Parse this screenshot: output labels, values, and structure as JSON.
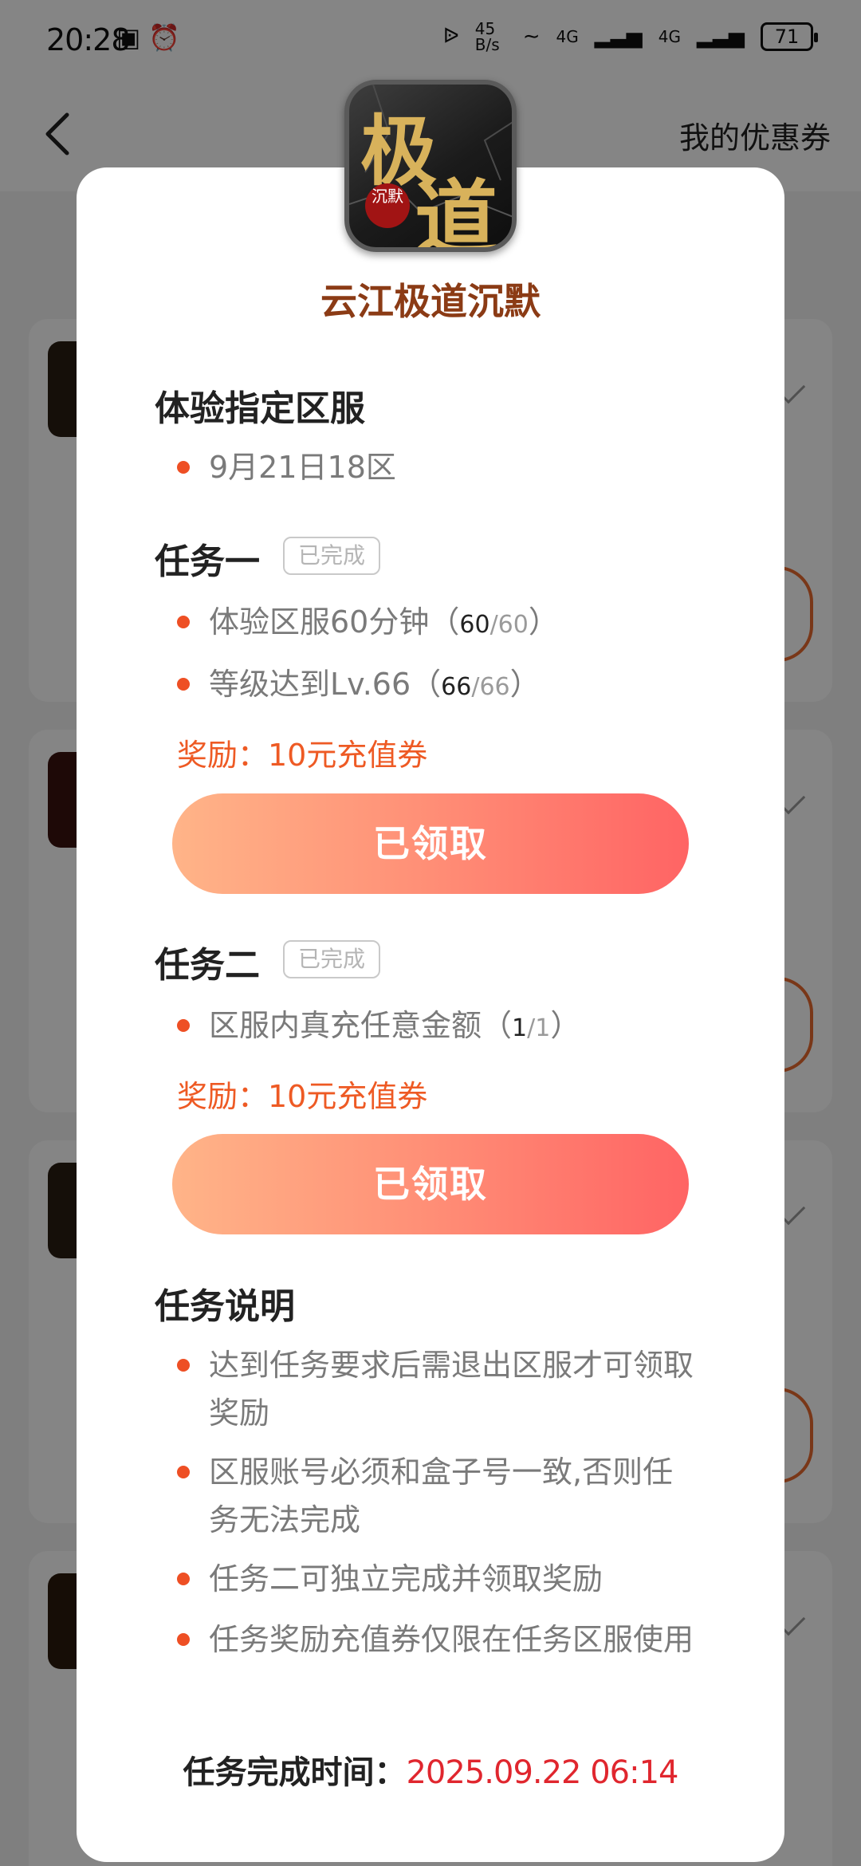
{
  "status_bar": {
    "time": "20:28",
    "net_speed": "45 B/s",
    "sim1": "4G",
    "sim2": "4G",
    "battery": "71"
  },
  "header": {
    "back_icon": "chevron-left-icon",
    "right_link": "我的优惠券"
  },
  "modal": {
    "game_icon_chars": [
      "极",
      "道"
    ],
    "game_icon_seal": "沉默",
    "game_name": "云江极道沉默",
    "server_section": {
      "title": "体验指定区服",
      "items": [
        "9月21日18区"
      ]
    },
    "task1": {
      "title": "任务一",
      "badge": "已完成",
      "items": [
        {
          "text": "体验区服60分钟",
          "open": "（",
          "current": "60",
          "sep": "/",
          "total": "60",
          "close": "）"
        },
        {
          "text": "等级达到Lv.66",
          "open": "（",
          "current": "66",
          "sep": "/",
          "total": "66",
          "close": "）"
        }
      ],
      "reward": "奖励：10元充值券",
      "button": "已领取"
    },
    "task2": {
      "title": "任务二",
      "badge": "已完成",
      "items": [
        {
          "text": "区服内真充任意金额",
          "open": "（",
          "current": "1",
          "sep": "/",
          "total": "1",
          "close": "）"
        }
      ],
      "reward": "奖励：10元充值券",
      "button": "已领取"
    },
    "notes": {
      "title": "任务说明",
      "items": [
        "达到任务要求后需退出区服才可领取奖励",
        "区服账号必须和盒子号一致,否则任务无法完成",
        "任务二可独立完成并领取奖励",
        "任务奖励充值券仅限在任务区服使用"
      ]
    },
    "completion": {
      "label": "任务完成时间：",
      "time": "2025.09.22 06:14"
    }
  },
  "colors": {
    "accent": "#ee5a24",
    "game_name": "#8b3b15",
    "time_red": "#e0262e",
    "button_start": "#ffb488",
    "button_end": "#ff6464"
  }
}
